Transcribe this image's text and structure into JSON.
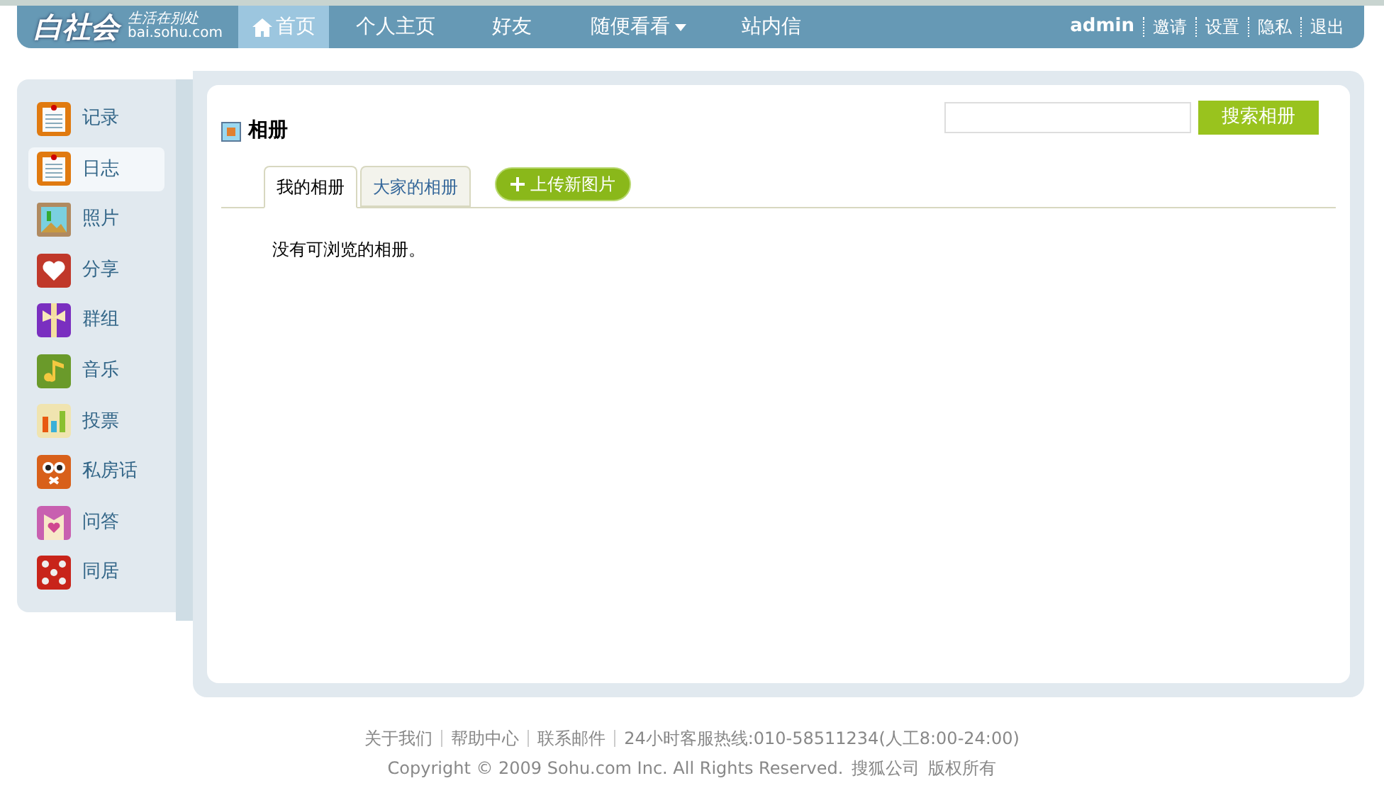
{
  "logo": {
    "name": "白社会",
    "slogan": "生活在别处",
    "domain": "bai.sohu.com"
  },
  "nav": [
    {
      "label": "首页",
      "selected": true,
      "dropdown": false
    },
    {
      "label": "个人主页",
      "selected": false,
      "dropdown": false
    },
    {
      "label": "好友",
      "selected": false,
      "dropdown": false
    },
    {
      "label": "随便看看",
      "selected": false,
      "dropdown": true
    },
    {
      "label": "站内信",
      "selected": false,
      "dropdown": false
    }
  ],
  "user": "admin",
  "user_links": [
    "邀请",
    "设置",
    "隐私",
    "退出"
  ],
  "sidebar": {
    "items": [
      {
        "label": "记录",
        "selected": false
      },
      {
        "label": "日志",
        "selected": true
      },
      {
        "label": "照片",
        "selected": false
      },
      {
        "label": "分享",
        "selected": false
      },
      {
        "label": "群组",
        "selected": false
      },
      {
        "label": "音乐",
        "selected": false
      },
      {
        "label": "投票",
        "selected": false
      },
      {
        "label": "私房话",
        "selected": false
      },
      {
        "label": "问答",
        "selected": false
      },
      {
        "label": "同居",
        "selected": false
      }
    ]
  },
  "page": {
    "title": "相册",
    "search_button": "搜索相册",
    "tabs": [
      {
        "label": "我的相册",
        "selected": true
      },
      {
        "label": "大家的相册",
        "selected": false
      }
    ],
    "upload_button": "上传新图片",
    "empty_message": "没有可浏览的相册。"
  },
  "footer": {
    "links": [
      "关于我们",
      "帮助中心",
      "联系邮件"
    ],
    "hotline": "24小时客服热线:010-58511234(人工8:00-24:00)",
    "copyright": "Copyright © 2009 Sohu.com Inc. All Rights Reserved.",
    "company": "搜狐公司",
    "rights": "版权所有"
  }
}
